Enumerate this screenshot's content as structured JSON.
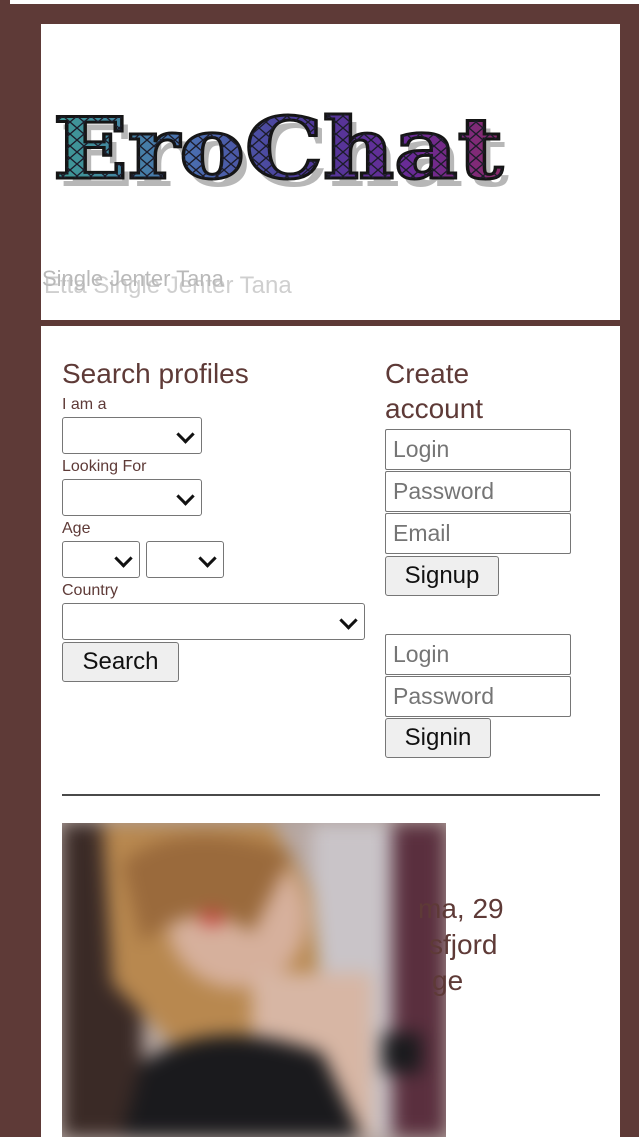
{
  "header": {
    "logo_text": "EroChat",
    "subtitle_back": "Etta Single Jenter Tana",
    "subtitle_front": "Single Jenter Tana"
  },
  "search": {
    "title": "Search profiles",
    "i_am_label": "I am a",
    "looking_for_label": "Looking For",
    "age_label": "Age",
    "country_label": "Country",
    "button_label": "Search"
  },
  "create_account": {
    "title_line1": "Create",
    "title_line2": "account",
    "login_placeholder": "Login",
    "password_placeholder": "Password",
    "email_placeholder": "Email",
    "button_label": "Signup"
  },
  "signin": {
    "login_placeholder": "Login",
    "password_placeholder": "Password",
    "button_label": "Signin"
  },
  "profile": {
    "line1": "ma, 29",
    "line2": "sfjord",
    "line3": "ge"
  },
  "colors": {
    "brand": "#5e3a37",
    "panel": "#ffffff"
  }
}
